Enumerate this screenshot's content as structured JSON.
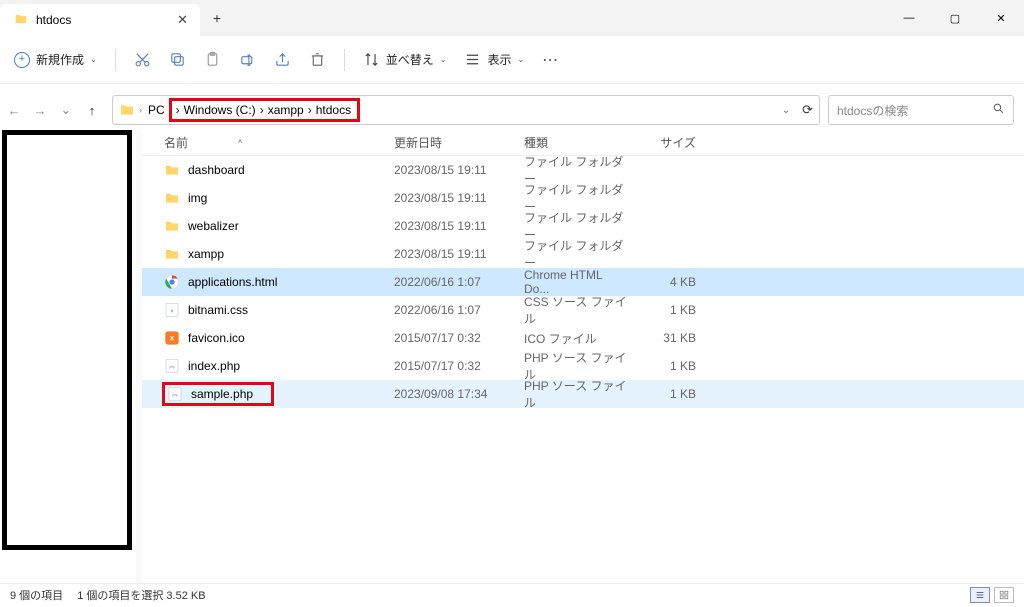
{
  "window": {
    "tab_title": "htdocs",
    "min": "—",
    "max": "▢",
    "close": "✕",
    "newtab": "+"
  },
  "toolbar": {
    "new_label": "新規作成",
    "sort_label": "並べ替え",
    "view_label": "表示",
    "more": "⋯"
  },
  "nav": {
    "back": "←",
    "forward": "→",
    "dropdown": "⌄",
    "up": "↑",
    "refresh": "⟳",
    "addr_dropdown": "⌄"
  },
  "breadcrumb": {
    "pc": "PC",
    "drive": "Windows (C:)",
    "folder1": "xampp",
    "folder2": "htdocs",
    "sep": "›"
  },
  "search": {
    "placeholder": "htdocsの検索"
  },
  "columns": {
    "name": "名前",
    "date": "更新日時",
    "type": "種類",
    "size": "サイズ",
    "sort_indicator": "˄"
  },
  "files": [
    {
      "name": "dashboard",
      "date": "2023/08/15 19:11",
      "type": "ファイル フォルダー",
      "size": "",
      "icon": "folder",
      "selected": false,
      "highlighted": false,
      "redbox": false
    },
    {
      "name": "img",
      "date": "2023/08/15 19:11",
      "type": "ファイル フォルダー",
      "size": "",
      "icon": "folder",
      "selected": false,
      "highlighted": false,
      "redbox": false
    },
    {
      "name": "webalizer",
      "date": "2023/08/15 19:11",
      "type": "ファイル フォルダー",
      "size": "",
      "icon": "folder",
      "selected": false,
      "highlighted": false,
      "redbox": false
    },
    {
      "name": "xampp",
      "date": "2023/08/15 19:11",
      "type": "ファイル フォルダー",
      "size": "",
      "icon": "folder",
      "selected": false,
      "highlighted": false,
      "redbox": false
    },
    {
      "name": "applications.html",
      "date": "2022/06/16 1:07",
      "type": "Chrome HTML Do...",
      "size": "4 KB",
      "icon": "chrome",
      "selected": true,
      "highlighted": false,
      "redbox": false
    },
    {
      "name": "bitnami.css",
      "date": "2022/06/16 1:07",
      "type": "CSS ソース ファイル",
      "size": "1 KB",
      "icon": "css",
      "selected": false,
      "highlighted": false,
      "redbox": false
    },
    {
      "name": "favicon.ico",
      "date": "2015/07/17 0:32",
      "type": "ICO ファイル",
      "size": "31 KB",
      "icon": "xampp",
      "selected": false,
      "highlighted": false,
      "redbox": false
    },
    {
      "name": "index.php",
      "date": "2015/07/17 0:32",
      "type": "PHP ソース ファイル",
      "size": "1 KB",
      "icon": "php",
      "selected": false,
      "highlighted": false,
      "redbox": false
    },
    {
      "name": "sample.php",
      "date": "2023/09/08 17:34",
      "type": "PHP ソース ファイル",
      "size": "1 KB",
      "icon": "php",
      "selected": false,
      "highlighted": true,
      "redbox": true
    }
  ],
  "status": {
    "items": "9 個の項目",
    "selected": "1 個の項目を選択 3.52 KB"
  },
  "colors": {
    "accent_red": "#e30613",
    "selection": "#cde8ff",
    "highlight": "#e5f3ff"
  }
}
